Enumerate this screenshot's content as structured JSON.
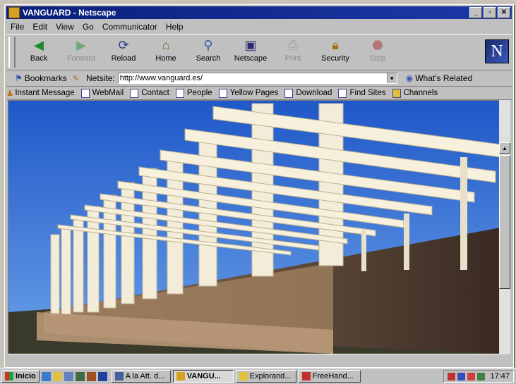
{
  "window": {
    "title": "VANGUARD - Netscape"
  },
  "menu": [
    "File",
    "Edit",
    "View",
    "Go",
    "Communicator",
    "Help"
  ],
  "toolbar": [
    {
      "label": "Back",
      "icon": "back-arrow",
      "disabled": false
    },
    {
      "label": "Forward",
      "icon": "forward-arrow",
      "disabled": true
    },
    {
      "label": "Reload",
      "icon": "reload",
      "disabled": false
    },
    {
      "label": "Home",
      "icon": "home",
      "disabled": false
    },
    {
      "label": "Search",
      "icon": "search",
      "disabled": false
    },
    {
      "label": "Netscape",
      "icon": "netscape",
      "disabled": false
    },
    {
      "label": "Print",
      "icon": "print",
      "disabled": true
    },
    {
      "label": "Security",
      "icon": "lock",
      "disabled": false
    },
    {
      "label": "Stop",
      "icon": "stop",
      "disabled": true
    }
  ],
  "location": {
    "bookmarks_label": "Bookmarks",
    "netsite_label": "Netsite:",
    "url": "http://www.vanguard.es/",
    "whats_related": "What's Related"
  },
  "personal": [
    "Instant Message",
    "WebMail",
    "Contact",
    "People",
    "Yellow Pages",
    "Download",
    "Find Sites",
    "Channels"
  ],
  "taskbar": {
    "start": "Inicio",
    "items": [
      {
        "label": "A la Att. d...",
        "active": false
      },
      {
        "label": "VANGU...",
        "active": true
      },
      {
        "label": "Explorand...",
        "active": false
      },
      {
        "label": "FreeHand...",
        "active": false
      }
    ],
    "clock": "17:47"
  },
  "colors": {
    "titlebar": "#0a1e7a",
    "chrome": "#c0c0c0",
    "sky": "#2a64d0"
  }
}
